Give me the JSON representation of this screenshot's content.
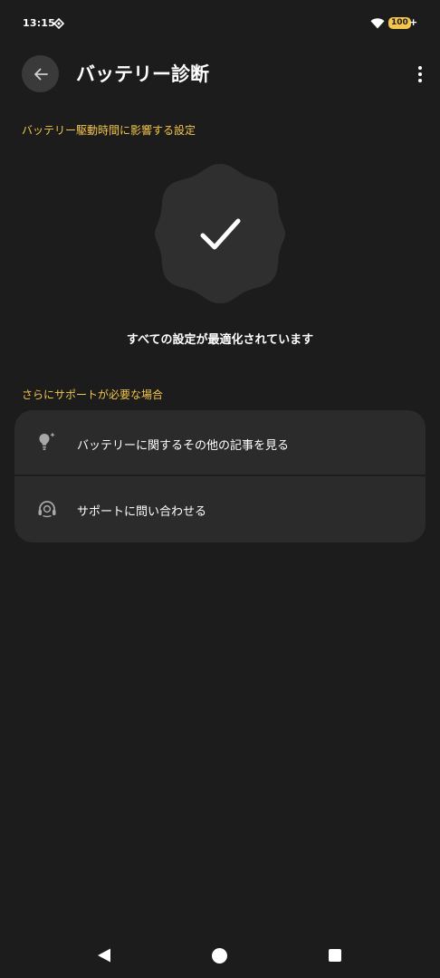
{
  "status_bar": {
    "time": "13:15",
    "battery": "100",
    "battery_plus": "+"
  },
  "header": {
    "title": "バッテリー診断"
  },
  "sections": {
    "settings_header": "バッテリー駆動時間に影響する設定",
    "support_header": "さらにサポートが必要な場合"
  },
  "status": {
    "message": "すべての設定が最適化されています"
  },
  "support_items": [
    {
      "label": "バッテリーに関するその他の記事を見る",
      "icon": "lightbulb-icon"
    },
    {
      "label": "サポートに問い合わせる",
      "icon": "headset-icon"
    }
  ],
  "colors": {
    "background": "#1c1c1c",
    "accent": "#f3c54a",
    "card": "#2b2b2b",
    "badge": "#2f2f2f"
  }
}
